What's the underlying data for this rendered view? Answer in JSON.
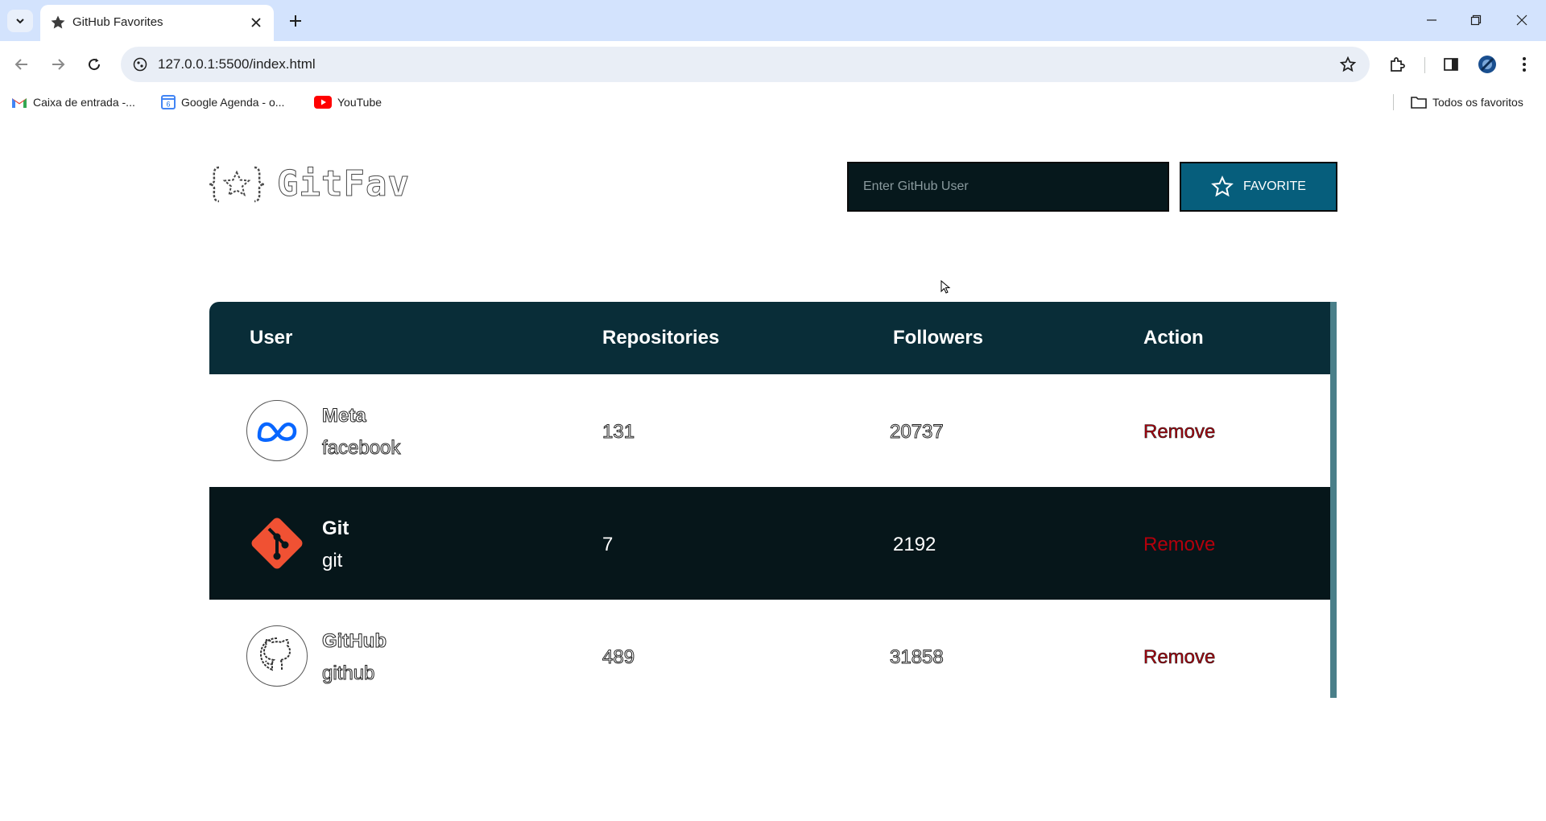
{
  "browser": {
    "tab_title": "GitHub Favorites",
    "url": "127.0.0.1:5500/index.html",
    "bookmarks": [
      {
        "label": "Caixa de entrada -...",
        "icon": "gmail-icon"
      },
      {
        "label": "Google Agenda - o...",
        "icon": "google-calendar-icon"
      },
      {
        "label": "YouTube",
        "icon": "youtube-icon"
      }
    ],
    "all_bookmarks_label": "Todos os favoritos"
  },
  "app": {
    "logo_text": "GitFav",
    "search_placeholder": "Enter GitHub User",
    "favorite_label": "FAVORITE",
    "colors": {
      "header_bg": "#092d38",
      "button_bg": "#065e7c",
      "input_bg": "#06181c",
      "dark_row_bg": "#06161a",
      "remove": "#b3000c"
    }
  },
  "table": {
    "headers": {
      "user": "User",
      "repositories": "Repositories",
      "followers": "Followers",
      "action": "Action"
    },
    "rows": [
      {
        "name": "Meta",
        "login": "facebook",
        "repositories": "131",
        "followers": "20737",
        "action": "Remove",
        "avatar": "meta-logo-icon"
      },
      {
        "name": "Git",
        "login": "git",
        "repositories": "7",
        "followers": "2192",
        "action": "Remove",
        "avatar": "git-logo-icon"
      },
      {
        "name": "GitHub",
        "login": "github",
        "repositories": "489",
        "followers": "31858",
        "action": "Remove",
        "avatar": "github-octocat-icon"
      }
    ]
  }
}
